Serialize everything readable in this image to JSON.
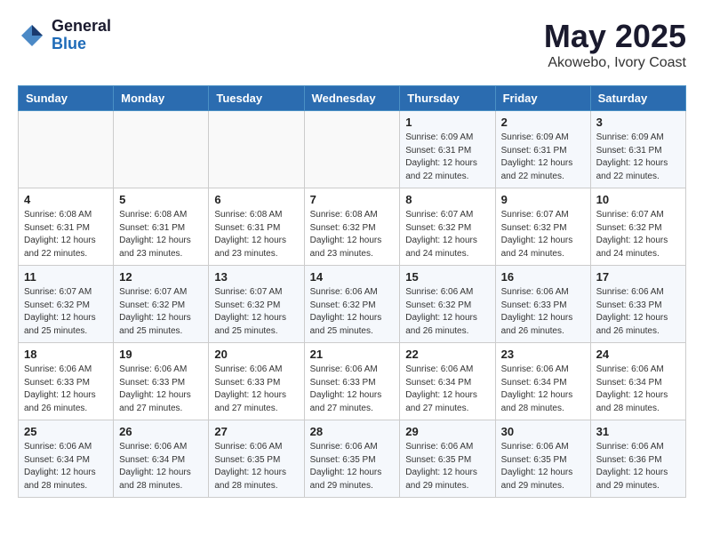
{
  "header": {
    "logo_general": "General",
    "logo_blue": "Blue",
    "month": "May 2025",
    "location": "Akowebo, Ivory Coast"
  },
  "days_of_week": [
    "Sunday",
    "Monday",
    "Tuesday",
    "Wednesday",
    "Thursday",
    "Friday",
    "Saturday"
  ],
  "weeks": [
    [
      {
        "day": "",
        "info": ""
      },
      {
        "day": "",
        "info": ""
      },
      {
        "day": "",
        "info": ""
      },
      {
        "day": "",
        "info": ""
      },
      {
        "day": "1",
        "info": "Sunrise: 6:09 AM\nSunset: 6:31 PM\nDaylight: 12 hours\nand 22 minutes."
      },
      {
        "day": "2",
        "info": "Sunrise: 6:09 AM\nSunset: 6:31 PM\nDaylight: 12 hours\nand 22 minutes."
      },
      {
        "day": "3",
        "info": "Sunrise: 6:09 AM\nSunset: 6:31 PM\nDaylight: 12 hours\nand 22 minutes."
      }
    ],
    [
      {
        "day": "4",
        "info": "Sunrise: 6:08 AM\nSunset: 6:31 PM\nDaylight: 12 hours\nand 22 minutes."
      },
      {
        "day": "5",
        "info": "Sunrise: 6:08 AM\nSunset: 6:31 PM\nDaylight: 12 hours\nand 23 minutes."
      },
      {
        "day": "6",
        "info": "Sunrise: 6:08 AM\nSunset: 6:31 PM\nDaylight: 12 hours\nand 23 minutes."
      },
      {
        "day": "7",
        "info": "Sunrise: 6:08 AM\nSunset: 6:32 PM\nDaylight: 12 hours\nand 23 minutes."
      },
      {
        "day": "8",
        "info": "Sunrise: 6:07 AM\nSunset: 6:32 PM\nDaylight: 12 hours\nand 24 minutes."
      },
      {
        "day": "9",
        "info": "Sunrise: 6:07 AM\nSunset: 6:32 PM\nDaylight: 12 hours\nand 24 minutes."
      },
      {
        "day": "10",
        "info": "Sunrise: 6:07 AM\nSunset: 6:32 PM\nDaylight: 12 hours\nand 24 minutes."
      }
    ],
    [
      {
        "day": "11",
        "info": "Sunrise: 6:07 AM\nSunset: 6:32 PM\nDaylight: 12 hours\nand 25 minutes."
      },
      {
        "day": "12",
        "info": "Sunrise: 6:07 AM\nSunset: 6:32 PM\nDaylight: 12 hours\nand 25 minutes."
      },
      {
        "day": "13",
        "info": "Sunrise: 6:07 AM\nSunset: 6:32 PM\nDaylight: 12 hours\nand 25 minutes."
      },
      {
        "day": "14",
        "info": "Sunrise: 6:06 AM\nSunset: 6:32 PM\nDaylight: 12 hours\nand 25 minutes."
      },
      {
        "day": "15",
        "info": "Sunrise: 6:06 AM\nSunset: 6:32 PM\nDaylight: 12 hours\nand 26 minutes."
      },
      {
        "day": "16",
        "info": "Sunrise: 6:06 AM\nSunset: 6:33 PM\nDaylight: 12 hours\nand 26 minutes."
      },
      {
        "day": "17",
        "info": "Sunrise: 6:06 AM\nSunset: 6:33 PM\nDaylight: 12 hours\nand 26 minutes."
      }
    ],
    [
      {
        "day": "18",
        "info": "Sunrise: 6:06 AM\nSunset: 6:33 PM\nDaylight: 12 hours\nand 26 minutes."
      },
      {
        "day": "19",
        "info": "Sunrise: 6:06 AM\nSunset: 6:33 PM\nDaylight: 12 hours\nand 27 minutes."
      },
      {
        "day": "20",
        "info": "Sunrise: 6:06 AM\nSunset: 6:33 PM\nDaylight: 12 hours\nand 27 minutes."
      },
      {
        "day": "21",
        "info": "Sunrise: 6:06 AM\nSunset: 6:33 PM\nDaylight: 12 hours\nand 27 minutes."
      },
      {
        "day": "22",
        "info": "Sunrise: 6:06 AM\nSunset: 6:34 PM\nDaylight: 12 hours\nand 27 minutes."
      },
      {
        "day": "23",
        "info": "Sunrise: 6:06 AM\nSunset: 6:34 PM\nDaylight: 12 hours\nand 28 minutes."
      },
      {
        "day": "24",
        "info": "Sunrise: 6:06 AM\nSunset: 6:34 PM\nDaylight: 12 hours\nand 28 minutes."
      }
    ],
    [
      {
        "day": "25",
        "info": "Sunrise: 6:06 AM\nSunset: 6:34 PM\nDaylight: 12 hours\nand 28 minutes."
      },
      {
        "day": "26",
        "info": "Sunrise: 6:06 AM\nSunset: 6:34 PM\nDaylight: 12 hours\nand 28 minutes."
      },
      {
        "day": "27",
        "info": "Sunrise: 6:06 AM\nSunset: 6:35 PM\nDaylight: 12 hours\nand 28 minutes."
      },
      {
        "day": "28",
        "info": "Sunrise: 6:06 AM\nSunset: 6:35 PM\nDaylight: 12 hours\nand 29 minutes."
      },
      {
        "day": "29",
        "info": "Sunrise: 6:06 AM\nSunset: 6:35 PM\nDaylight: 12 hours\nand 29 minutes."
      },
      {
        "day": "30",
        "info": "Sunrise: 6:06 AM\nSunset: 6:35 PM\nDaylight: 12 hours\nand 29 minutes."
      },
      {
        "day": "31",
        "info": "Sunrise: 6:06 AM\nSunset: 6:36 PM\nDaylight: 12 hours\nand 29 minutes."
      }
    ]
  ]
}
